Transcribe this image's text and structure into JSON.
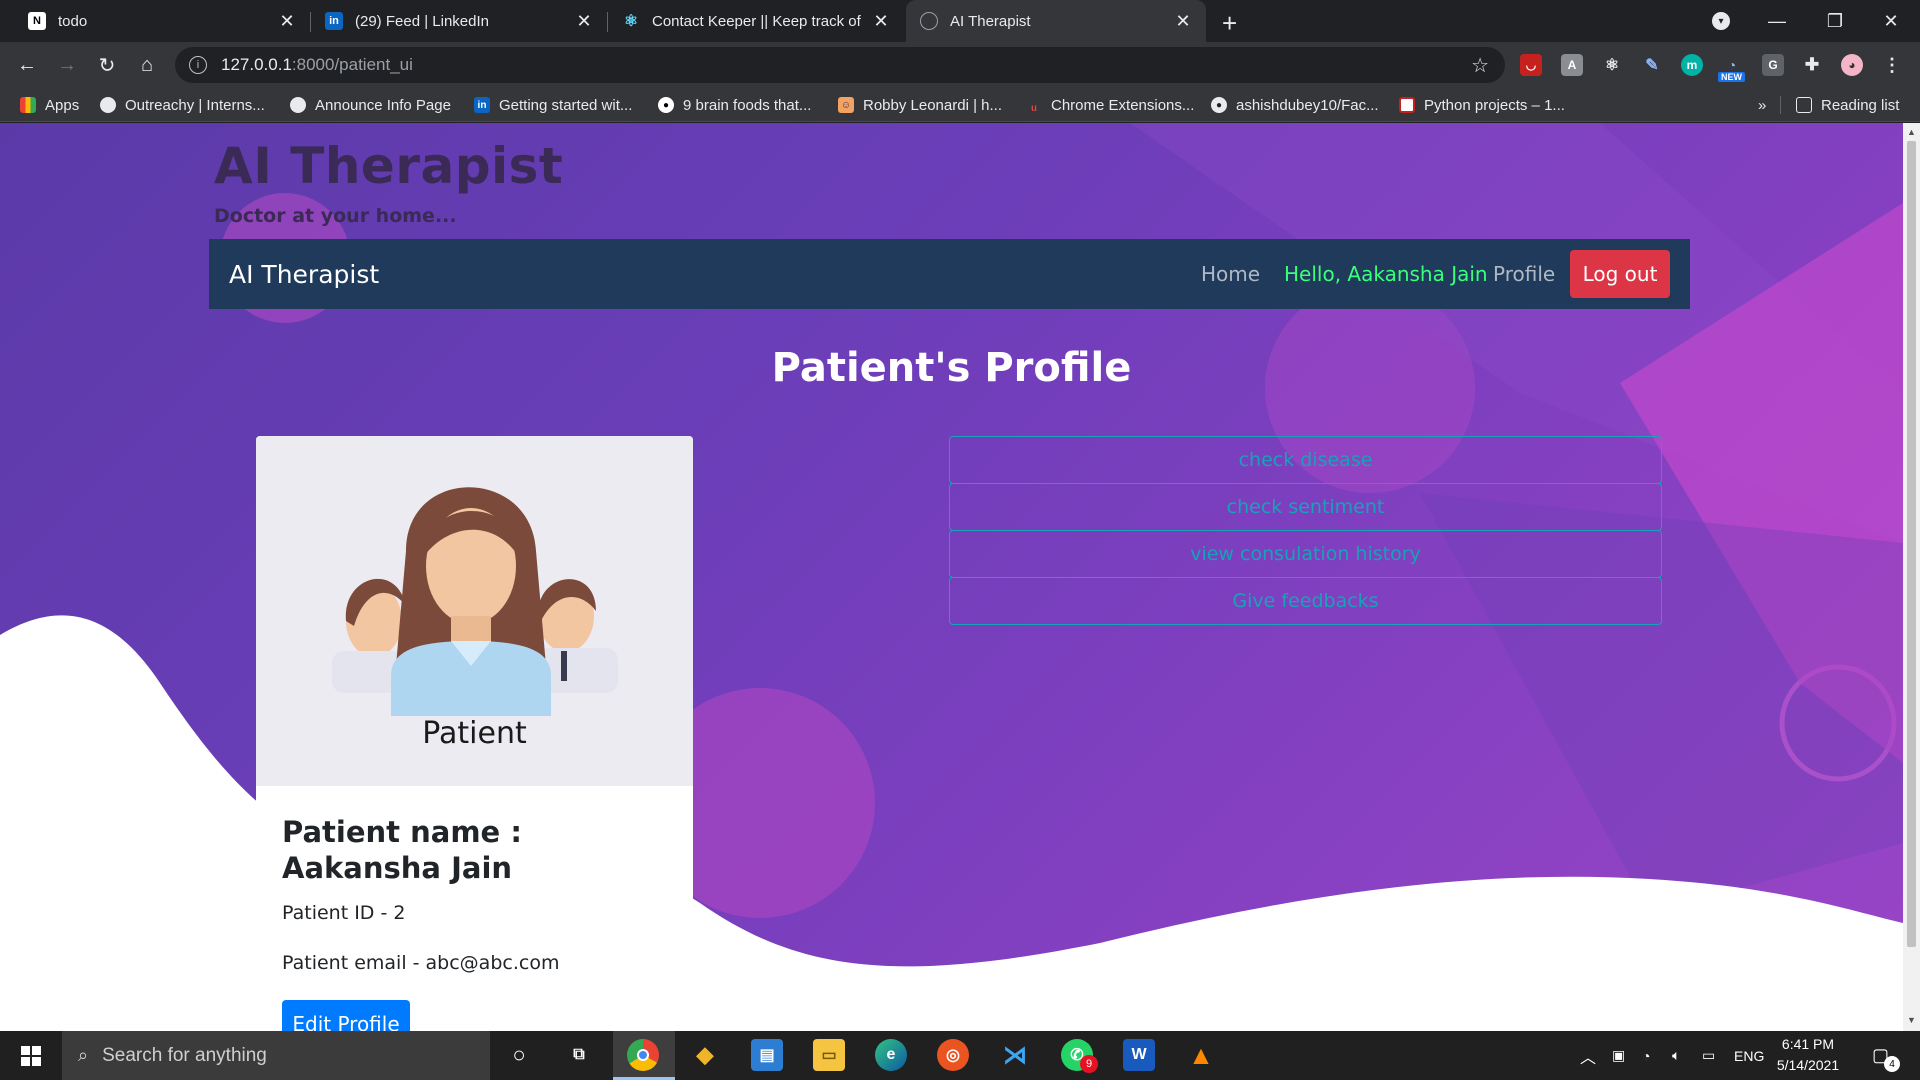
{
  "browser": {
    "tabs": [
      {
        "title": "todo",
        "icon": "notion-icon"
      },
      {
        "title": "(29) Feed | LinkedIn",
        "icon": "linkedin-icon"
      },
      {
        "title": "Contact Keeper || Keep track of y",
        "icon": "react-icon"
      },
      {
        "title": "AI Therapist",
        "icon": "globe-icon"
      }
    ],
    "new_tab": "+",
    "url_host": "127.0.0.1",
    "url_path": ":8000/patient_ui",
    "bookmarks": [
      {
        "label": "Apps"
      },
      {
        "label": "Outreachy | Interns..."
      },
      {
        "label": "Announce Info Page"
      },
      {
        "label": "Getting started wit..."
      },
      {
        "label": "9 brain foods that..."
      },
      {
        "label": "Robby Leonardi | h..."
      },
      {
        "label": "Chrome Extensions..."
      },
      {
        "label": "ashishdubey10/Fac..."
      },
      {
        "label": "Python projects – 1..."
      }
    ],
    "bookmarks_overflow": "»",
    "reading_list": "Reading list",
    "ext_badge": "NEW"
  },
  "site": {
    "title": "AI Therapist",
    "subtitle": "Doctor at your home...",
    "nav": {
      "brand": "AI Therapist",
      "home": "Home",
      "hello": "Hello, Aakansha Jain",
      "profile": "Profile",
      "logout": "Log out"
    },
    "heading": "Patient's Profile",
    "card": {
      "image_label": "Patient",
      "name": "Patient name : Aakansha Jain",
      "patient_id": "Patient ID - 2",
      "email": "Patient email - abc@abc.com",
      "edit_button": "Edit Profile"
    },
    "actions": [
      {
        "label": "check disease"
      },
      {
        "label": "check sentiment"
      },
      {
        "label": "view consulation history"
      },
      {
        "label": "Give feedbacks"
      }
    ],
    "colors": {
      "navbar": "#1f3a5b",
      "hello": "#39ff7a",
      "logout": "#dc3545",
      "edit": "#007bff",
      "action_outline": "#17a2b8"
    }
  },
  "taskbar": {
    "search_placeholder": "Search for anything",
    "language": "ENG",
    "time": "6:41 PM",
    "date": "5/14/2021",
    "notification_count": "4",
    "whatsapp_badge": "9"
  }
}
